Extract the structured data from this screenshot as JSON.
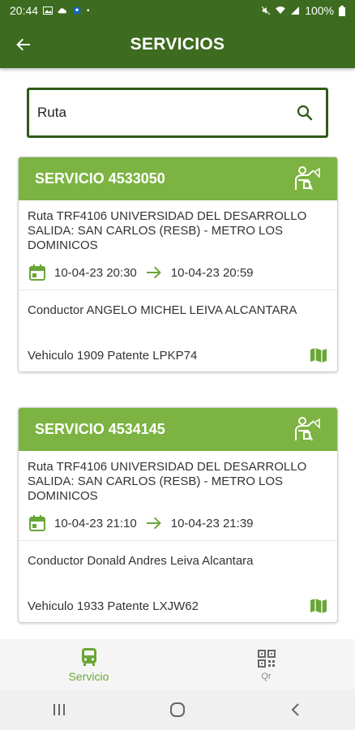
{
  "status_bar": {
    "time": "20:44",
    "battery": "100%"
  },
  "app_bar": {
    "title": "SERVICIOS"
  },
  "search": {
    "value": "Ruta",
    "placeholder": ""
  },
  "services": [
    {
      "title": "SERVICIO 4533050",
      "route": "Ruta TRF4106 UNIVERSIDAD DEL DESARROLLO SALIDA: SAN CARLOS (RESB) - METRO LOS DOMINICOS",
      "start": "10-04-23 20:30",
      "end": "10-04-23 20:59",
      "driver": "Conductor ANGELO MICHEL LEIVA ALCANTARA",
      "vehicle": "Vehiculo 1909 Patente LPKP74"
    },
    {
      "title": "SERVICIO 4534145",
      "route": "Ruta TRF4106 UNIVERSIDAD DEL DESARROLLO SALIDA: SAN CARLOS (RESB) - METRO LOS DOMINICOS",
      "start": "10-04-23 21:10",
      "end": "10-04-23 21:39",
      "driver": "Conductor Donald Andres Leiva Alcantara",
      "vehicle": "Vehiculo 1933 Patente LXJW62"
    }
  ],
  "bottom_nav": {
    "items": [
      {
        "label": "Servicio"
      },
      {
        "label": "Qr"
      }
    ]
  },
  "colors": {
    "app_bar": "#3d6b1f",
    "card_header": "#7cb342",
    "accent": "#6aa637"
  }
}
